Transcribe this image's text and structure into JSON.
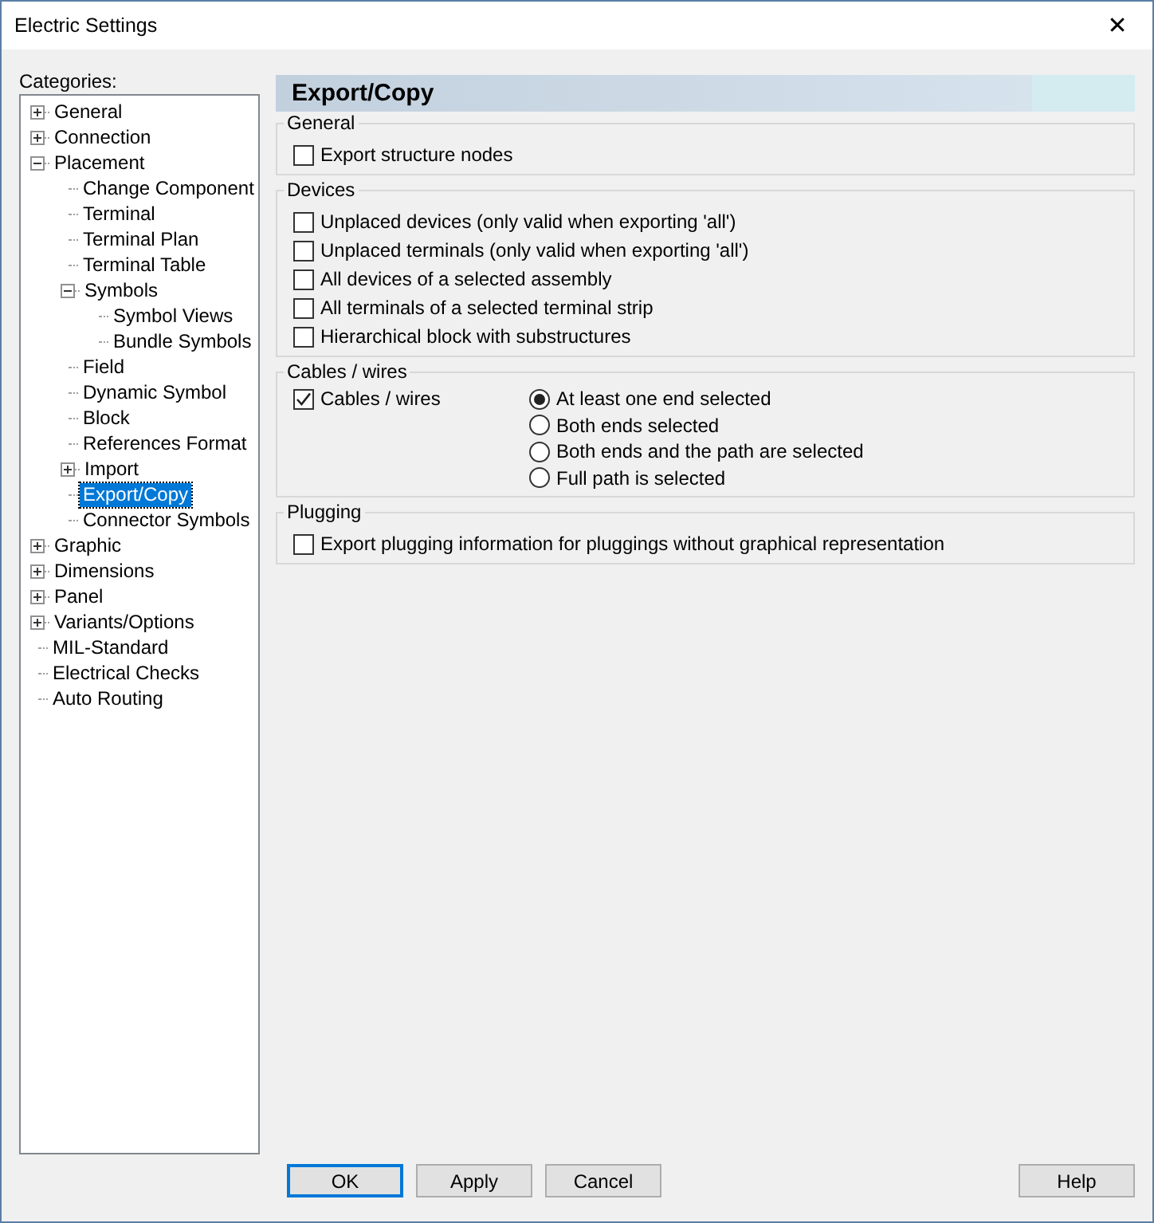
{
  "window": {
    "title": "Electric Settings",
    "close": "✕"
  },
  "categories_label": "Categories:",
  "tree": [
    {
      "label": "General",
      "expanded": false,
      "selected": false
    },
    {
      "label": "Connection",
      "expanded": false,
      "selected": false
    },
    {
      "label": "Placement",
      "expanded": true,
      "selected": false,
      "children": [
        {
          "label": "Change Component",
          "selected": false
        },
        {
          "label": "Terminal",
          "selected": false
        },
        {
          "label": "Terminal Plan",
          "selected": false
        },
        {
          "label": "Terminal Table",
          "selected": false
        },
        {
          "label": "Symbols",
          "expanded": true,
          "selected": false,
          "children": [
            {
              "label": "Symbol Views",
              "selected": false
            },
            {
              "label": "Bundle Symbols",
              "selected": false
            }
          ]
        },
        {
          "label": "Field",
          "selected": false
        },
        {
          "label": "Dynamic Symbol",
          "selected": false
        },
        {
          "label": "Block",
          "selected": false
        },
        {
          "label": "References Format",
          "selected": false
        },
        {
          "label": "Import",
          "expanded": false,
          "selected": false
        },
        {
          "label": "Export/Copy",
          "selected": true
        },
        {
          "label": "Connector Symbols",
          "selected": false
        }
      ]
    },
    {
      "label": "Graphic",
      "expanded": false,
      "selected": false
    },
    {
      "label": "Dimensions",
      "expanded": false,
      "selected": false
    },
    {
      "label": "Panel",
      "expanded": false,
      "selected": false
    },
    {
      "label": "Variants/Options",
      "expanded": false,
      "selected": false
    },
    {
      "label": "MIL-Standard",
      "selected": false
    },
    {
      "label": "Electrical Checks",
      "selected": false
    },
    {
      "label": "Auto Routing",
      "selected": false
    }
  ],
  "page_title": "Export/Copy",
  "groups": [
    {
      "title": "General",
      "options": [
        {
          "label": "Export structure nodes",
          "checked": false
        }
      ]
    },
    {
      "title": "Devices",
      "options": [
        {
          "label": "Unplaced devices (only valid when exporting 'all')",
          "checked": false
        },
        {
          "label": "Unplaced terminals (only valid when exporting 'all')",
          "checked": false
        },
        {
          "label": "All devices of a selected assembly",
          "checked": false
        },
        {
          "label": "All terminals of a selected terminal strip",
          "checked": false
        },
        {
          "label": "Hierarchical block with substructures",
          "checked": false
        }
      ]
    },
    {
      "title": "Cables / wires",
      "options": [
        {
          "label": "Cables / wires",
          "checked": true
        }
      ],
      "radios": [
        {
          "label": "At least one end selected",
          "selected": true
        },
        {
          "label": "Both ends selected",
          "selected": false
        },
        {
          "label": "Both ends and the path are selected",
          "selected": false
        },
        {
          "label": "Full path is selected",
          "selected": false
        }
      ]
    },
    {
      "title": "Plugging",
      "options": [
        {
          "label": "Export plugging information for pluggings without graphical representation",
          "checked": false
        }
      ]
    }
  ],
  "buttons": [
    {
      "label": "OK",
      "default": true
    },
    {
      "label": "Apply",
      "default": false
    },
    {
      "label": "Cancel",
      "default": false
    }
  ],
  "help_button": "Help"
}
